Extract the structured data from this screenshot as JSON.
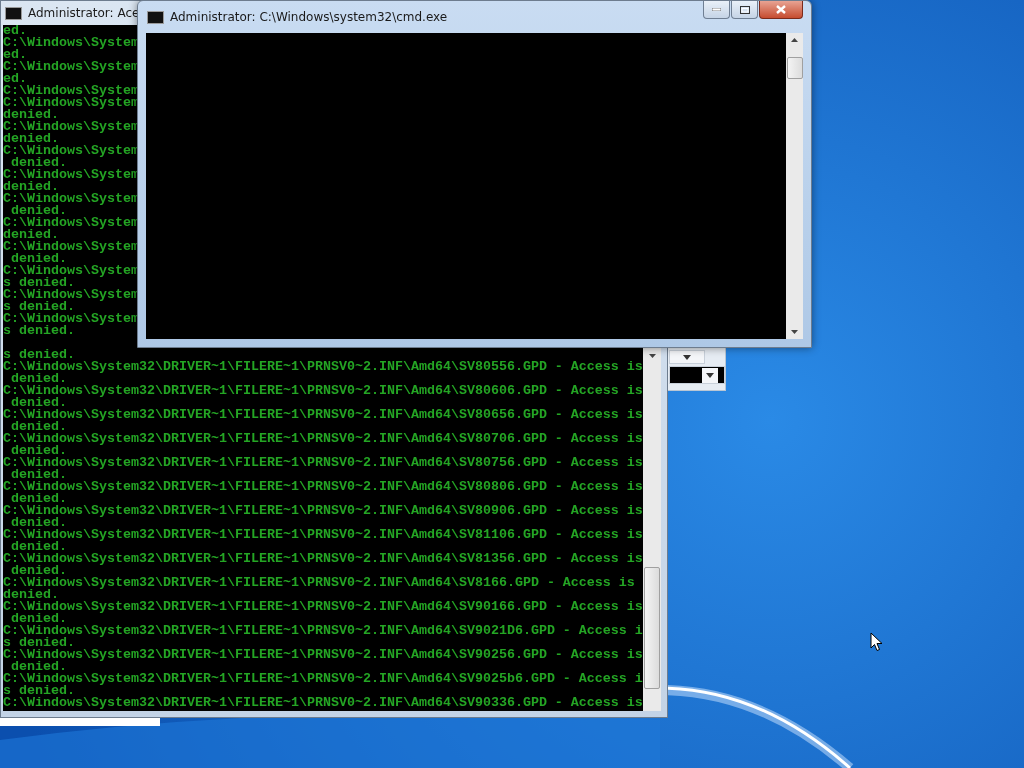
{
  "back_console": {
    "title": "Administrator: Ace",
    "upper_lines": [
      "ed.",
      "C:\\Windows\\System",
      "ed.",
      "C:\\Windows\\System",
      "ed.",
      "C:\\Windows\\System",
      "C:\\Windows\\System",
      "denied.",
      "C:\\Windows\\System",
      "denied.",
      "C:\\Windows\\System",
      " denied.",
      "C:\\Windows\\System",
      "denied.",
      "C:\\Windows\\System",
      " denied.",
      "C:\\Windows\\System",
      "denied.",
      "C:\\Windows\\System",
      " denied.",
      "C:\\Windows\\System",
      "s denied.",
      "C:\\Windows\\System",
      "s denied.",
      "C:\\Windows\\System",
      "s denied."
    ],
    "lower_lines": [
      "s denied.",
      "C:\\Windows\\System32\\DRIVER~1\\FILERE~1\\PRNSV0~2.INF\\Amd64\\SV80556.GPD - Access is",
      " denied.",
      "C:\\Windows\\System32\\DRIVER~1\\FILERE~1\\PRNSV0~2.INF\\Amd64\\SV80606.GPD - Access is",
      " denied.",
      "C:\\Windows\\System32\\DRIVER~1\\FILERE~1\\PRNSV0~2.INF\\Amd64\\SV80656.GPD - Access is",
      " denied.",
      "C:\\Windows\\System32\\DRIVER~1\\FILERE~1\\PRNSV0~2.INF\\Amd64\\SV80706.GPD - Access is",
      " denied.",
      "C:\\Windows\\System32\\DRIVER~1\\FILERE~1\\PRNSV0~2.INF\\Amd64\\SV80756.GPD - Access is",
      " denied.",
      "C:\\Windows\\System32\\DRIVER~1\\FILERE~1\\PRNSV0~2.INF\\Amd64\\SV80806.GPD - Access is",
      " denied.",
      "C:\\Windows\\System32\\DRIVER~1\\FILERE~1\\PRNSV0~2.INF\\Amd64\\SV80906.GPD - Access is",
      " denied.",
      "C:\\Windows\\System32\\DRIVER~1\\FILERE~1\\PRNSV0~2.INF\\Amd64\\SV81106.GPD - Access is",
      " denied.",
      "C:\\Windows\\System32\\DRIVER~1\\FILERE~1\\PRNSV0~2.INF\\Amd64\\SV81356.GPD - Access is",
      " denied.",
      "C:\\Windows\\System32\\DRIVER~1\\FILERE~1\\PRNSV0~2.INF\\Amd64\\SV8166.GPD - Access is",
      "denied.",
      "C:\\Windows\\System32\\DRIVER~1\\FILERE~1\\PRNSV0~2.INF\\Amd64\\SV90166.GPD - Access is",
      " denied.",
      "C:\\Windows\\System32\\DRIVER~1\\FILERE~1\\PRNSV0~2.INF\\Amd64\\SV9021D6.GPD - Access i",
      "s denied.",
      "C:\\Windows\\System32\\DRIVER~1\\FILERE~1\\PRNSV0~2.INF\\Amd64\\SV90256.GPD - Access is",
      " denied.",
      "C:\\Windows\\System32\\DRIVER~1\\FILERE~1\\PRNSV0~2.INF\\Amd64\\SV9025b6.GPD - Access i",
      "s denied.",
      "C:\\Windows\\System32\\DRIVER~1\\FILERE~1\\PRNSV0~2.INF\\Amd64\\SV90336.GPD - Access is"
    ]
  },
  "front_console": {
    "title": "Administrator: C:\\Windows\\system32\\cmd.exe"
  }
}
